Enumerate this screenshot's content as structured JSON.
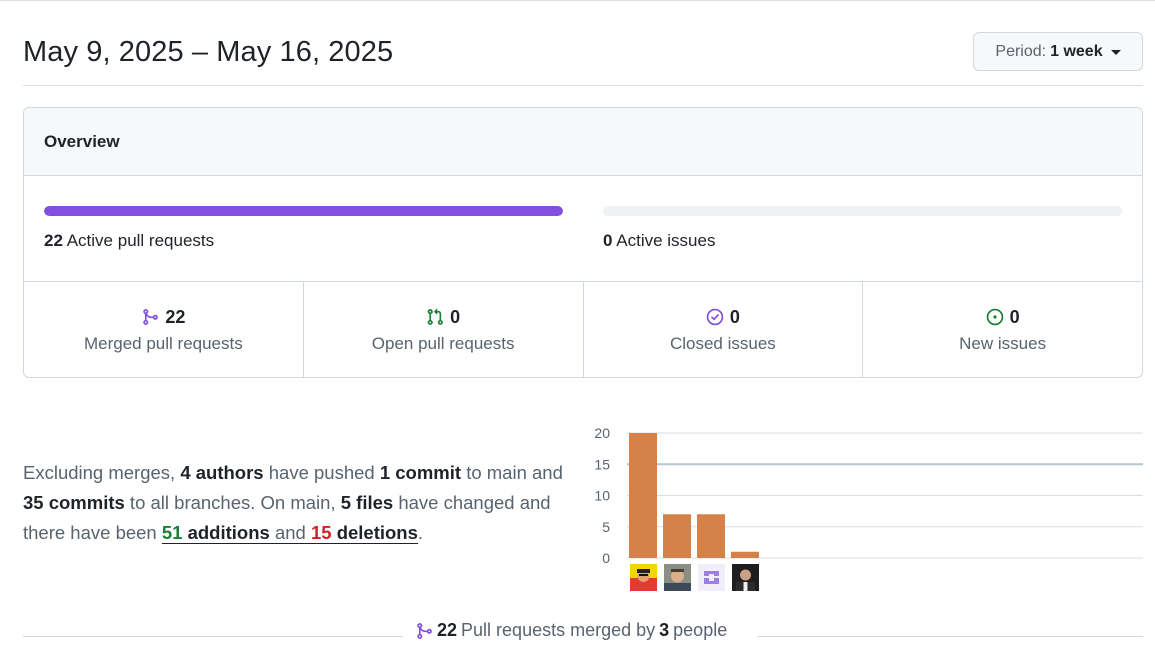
{
  "header": {
    "title": "May 9, 2025 – May 16, 2025",
    "period_prefix": "Period:",
    "period_value": "1 week"
  },
  "overview": {
    "title": "Overview",
    "pull_requests": {
      "count": "22",
      "label": "Active pull requests",
      "progress": 1.0,
      "color": "#8250df"
    },
    "issues": {
      "count": "0",
      "label": "Active issues",
      "progress": 0.0
    },
    "stats": [
      {
        "value": "22",
        "label": "Merged pull requests",
        "icon": "git-merge-icon",
        "color": "#8250df"
      },
      {
        "value": "0",
        "label": "Open pull requests",
        "icon": "git-pull-request-icon",
        "color": "#1a7f37"
      },
      {
        "value": "0",
        "label": "Closed issues",
        "icon": "issue-closed-icon",
        "color": "#8250df"
      },
      {
        "value": "0",
        "label": "New issues",
        "icon": "issue-opened-icon",
        "color": "#1a7f37"
      }
    ]
  },
  "summary": {
    "p1": "Excluding merges, ",
    "authors": "4 authors",
    "p2": " have pushed ",
    "main_commits": "1 commit",
    "p3": " to main and ",
    "all_commits": "35 commits",
    "p4": " to all branches. On main, ",
    "files": "5 files",
    "p5": " have changed and there have been ",
    "additions_num": "51",
    "additions_word": "additions",
    "and": "and",
    "deletions_num": "15",
    "deletions_word": "deletions",
    "end": "."
  },
  "chart_data": {
    "type": "bar",
    "categories": [
      "author-1",
      "author-2",
      "author-3",
      "author-4"
    ],
    "values": [
      20,
      7,
      7,
      1
    ],
    "ylim": [
      0,
      20
    ],
    "yticks": [
      0,
      5,
      10,
      15,
      20
    ],
    "bar_color": "#d4814a",
    "grid": true,
    "highlight_line": 15
  },
  "footer": {
    "count": "22",
    "text": "Pull requests merged by",
    "people_count": "3",
    "people_word": "people"
  }
}
